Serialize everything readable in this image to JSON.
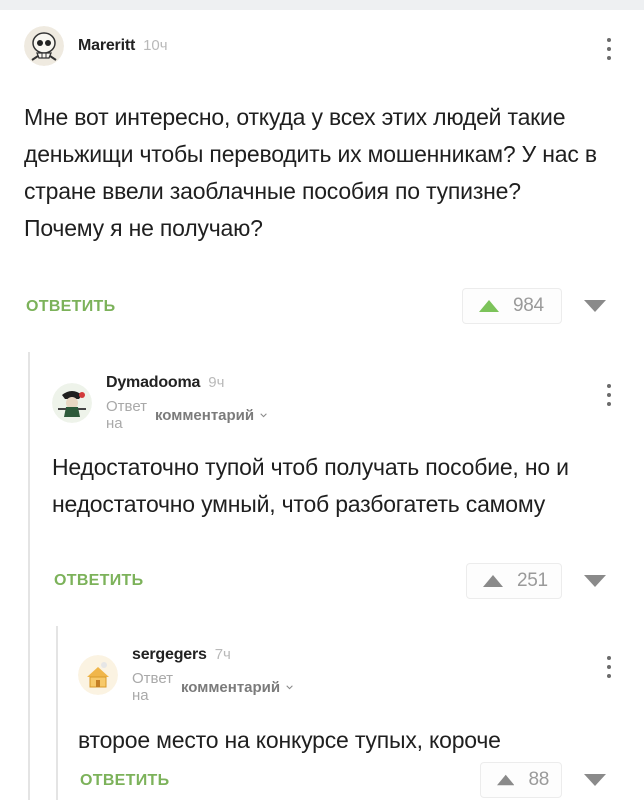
{
  "comments": [
    {
      "username": "Mareritt",
      "time": "10ч",
      "text": "Мне вот интересно, откуда у всех этих людей такие деньжищи чтобы переводить их мошенникам? У нас в стране ввели заоблачные пособия по тупизне? Почему я не получаю?",
      "reply_label": "ОТВЕТИТЬ",
      "rating": "984",
      "avatar_icon": "skull-avatar-icon"
    },
    {
      "username": "Dymadooma",
      "time": "9ч",
      "reply_prefix": "Ответ на",
      "reply_link": "комментарий",
      "text": "Недостаточно тупой чтоб получать пособие, но и недостаточно умный, чтоб разбогатеть самому",
      "reply_label": "ОТВЕТИТЬ",
      "rating": "251",
      "avatar_icon": "character-avatar-icon"
    },
    {
      "username": "sergegers",
      "time": "7ч",
      "reply_prefix": "Ответ на",
      "reply_link": "комментарий",
      "text": "второе место на конкурсе тупых, короче",
      "reply_label": "ОТВЕТИТЬ",
      "rating": "88",
      "avatar_icon": "house-avatar-icon"
    }
  ],
  "colors": {
    "accent_green": "#7cb25a",
    "upvote_green": "#7cc35a",
    "muted_text": "#a9a9a9",
    "thread_line": "#e4e4e4"
  }
}
